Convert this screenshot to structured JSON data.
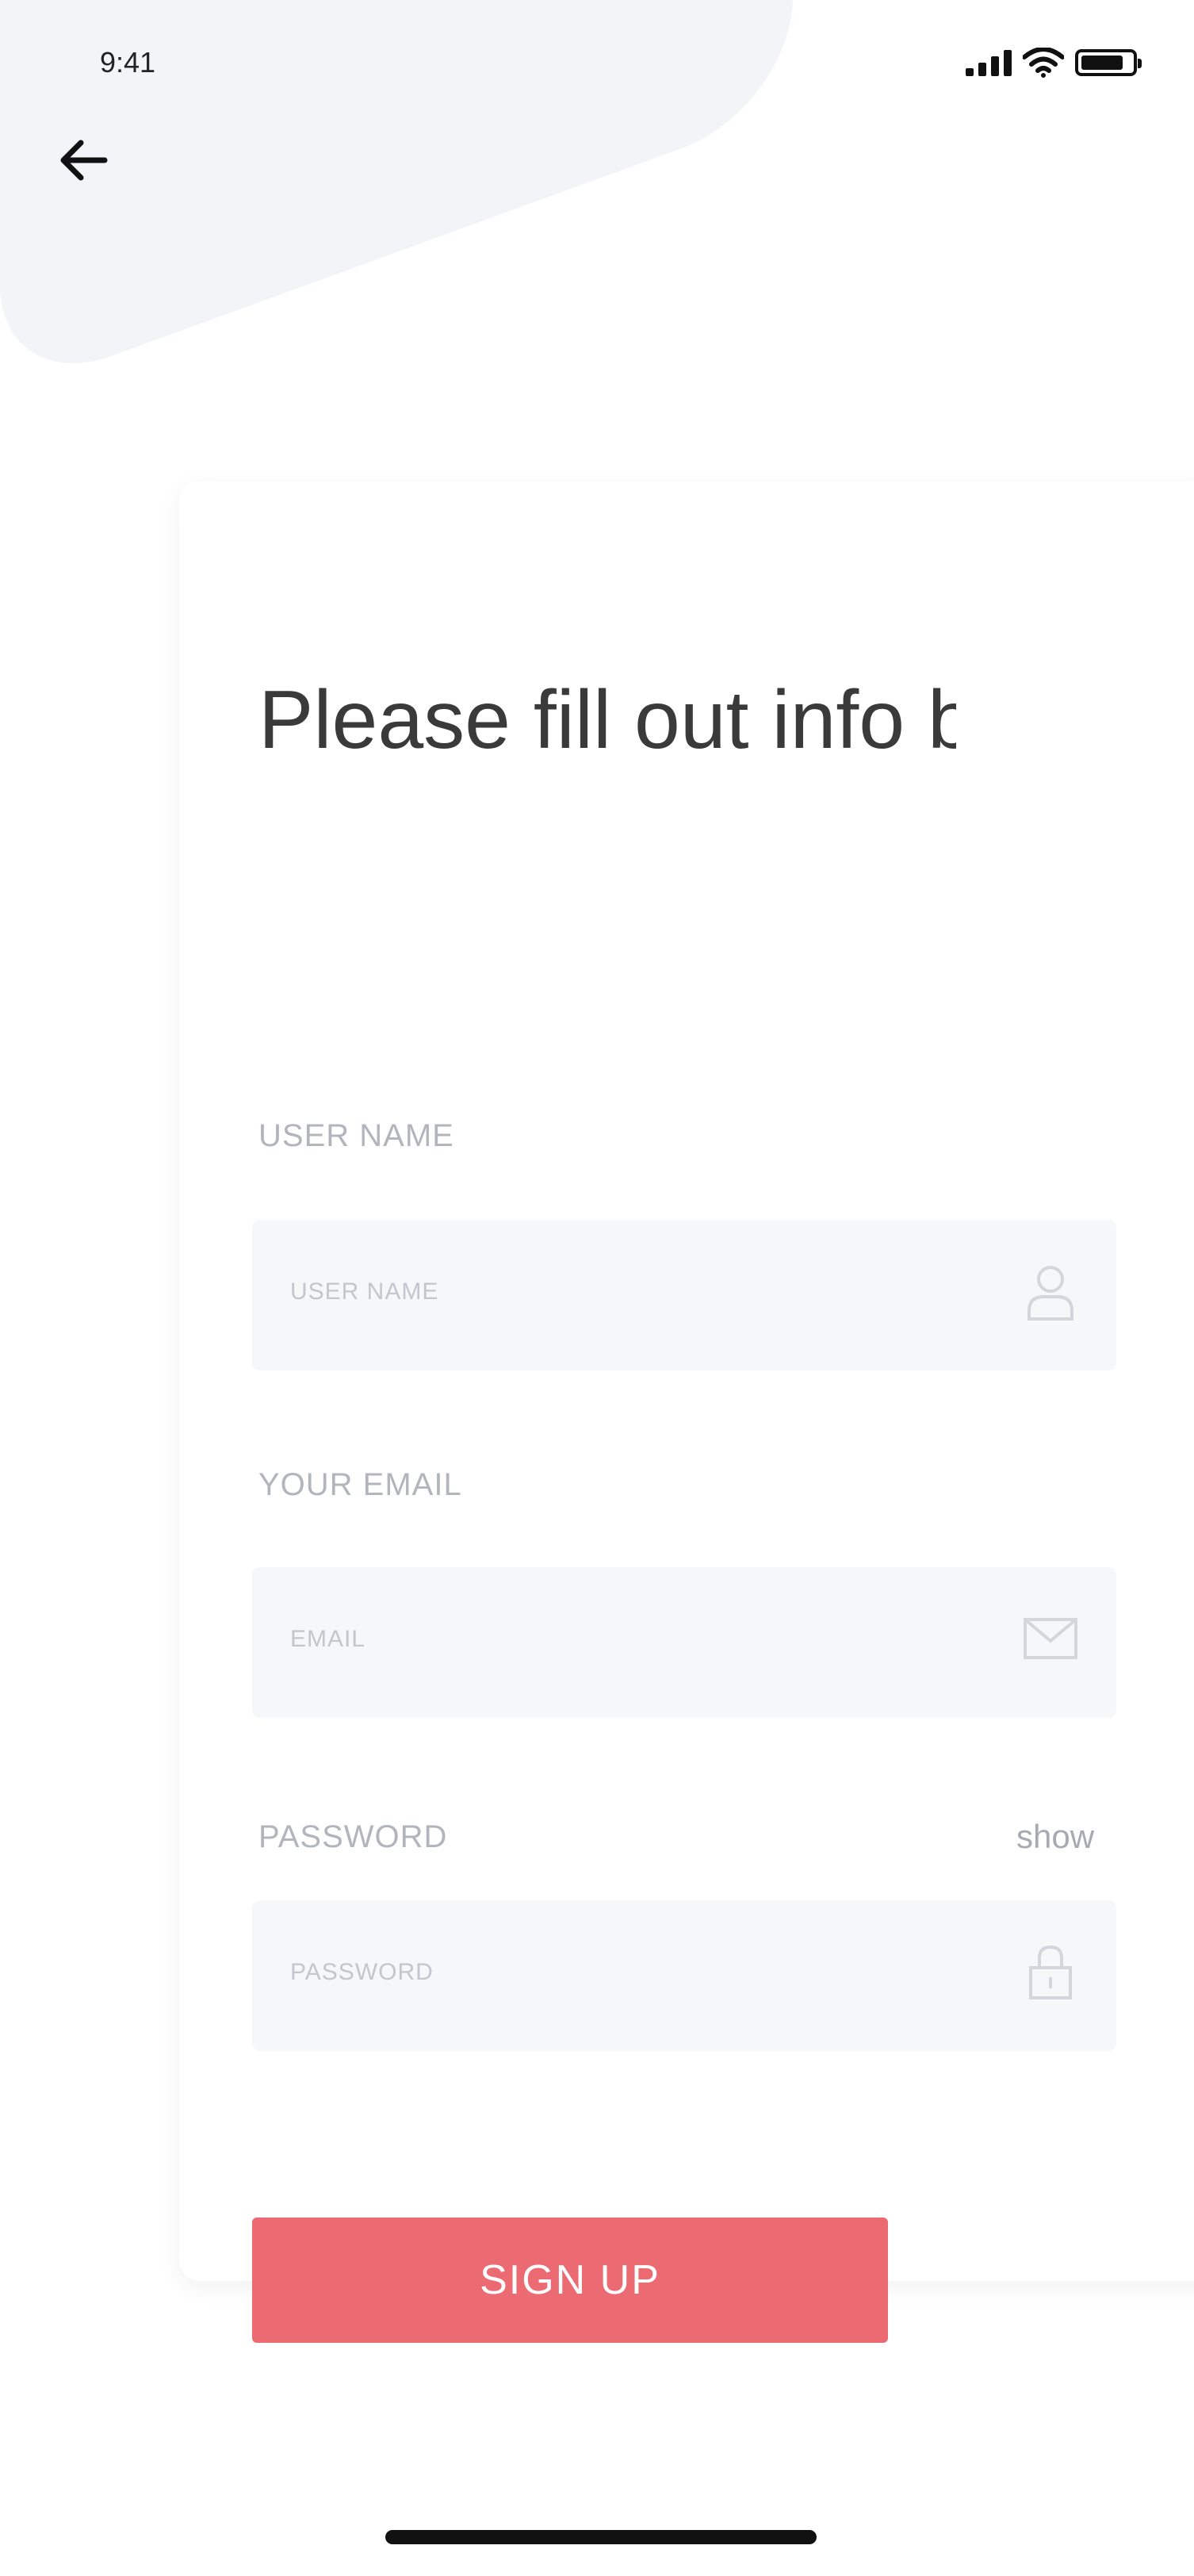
{
  "status_bar": {
    "time": "9:41",
    "icons": [
      "signal-icon",
      "wifi-icon",
      "battery-icon"
    ]
  },
  "nav": {
    "back_icon": "arrow-left-icon"
  },
  "form": {
    "heading": "Please fill out info below.",
    "username": {
      "label": "USER NAME",
      "placeholder": "USER NAME",
      "icon": "user-icon"
    },
    "email": {
      "label": "YOUR EMAIL",
      "placeholder": "EMAIL",
      "icon": "envelope-icon"
    },
    "password": {
      "label": "PASSWORD",
      "placeholder": "PASSWORD",
      "toggle_label": "show",
      "icon": "lock-icon"
    },
    "submit_label": "SIGN UP"
  },
  "colors": {
    "accent": "#ec6a72",
    "input_bg": "#f6f7f9",
    "label": "#b2b5bc",
    "heading": "#3a3a3a"
  }
}
